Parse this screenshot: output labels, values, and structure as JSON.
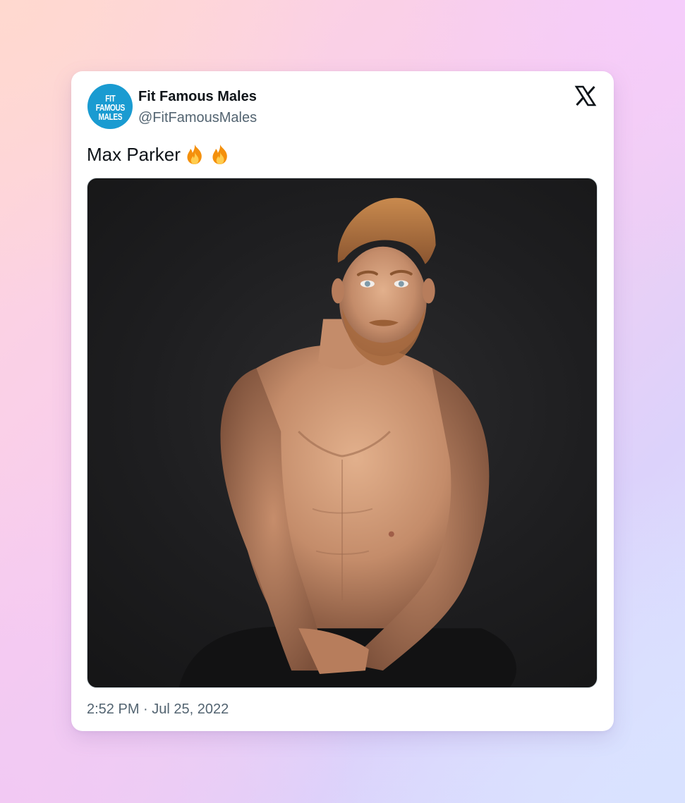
{
  "tweet": {
    "author": {
      "display_name": "Fit Famous Males",
      "handle": "@FitFamousMales",
      "avatar_text": "FIT\nFAMOUS\nMALES",
      "avatar_color": "#1a9bd1"
    },
    "text": "Max Parker",
    "emojis": [
      "fire-emoji",
      "fire-emoji"
    ],
    "timestamp": "2:52 PM · Jul 25, 2022",
    "platform_icon": "x-logo-icon"
  },
  "colors": {
    "card_bg": "#ffffff",
    "primary_text": "#0f1419",
    "secondary_text": "#536471",
    "media_bg": "#1e1e20"
  }
}
